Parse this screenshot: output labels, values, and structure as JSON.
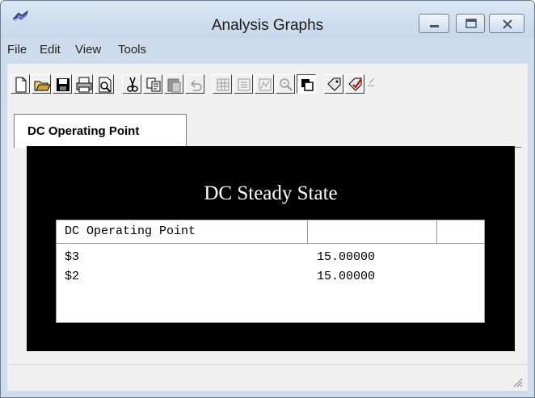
{
  "window": {
    "title": "Analysis Graphs"
  },
  "menu": {
    "items": [
      "File",
      "Edit",
      "View",
      "Tools"
    ]
  },
  "toolbar": {
    "icons": [
      "new-file-icon",
      "open-folder-icon",
      "save-icon",
      "print-icon",
      "print-preview-icon",
      "cut-icon",
      "copy-icon",
      "paste-icon",
      "undo-icon",
      "grid-icon",
      "list-icon",
      "chart-view-icon",
      "zoom-out-icon",
      "overlay-icon",
      "tag-icon",
      "edit-icon",
      "more-icon"
    ]
  },
  "tabs": [
    {
      "label": "DC Operating Point",
      "active": true
    }
  ],
  "graph": {
    "title": "DC Steady State",
    "table": {
      "header": [
        "DC Operating Point",
        "",
        ""
      ],
      "rows": [
        {
          "name": "$3",
          "value": "15.00000"
        },
        {
          "name": "$2",
          "value": "15.00000"
        }
      ]
    }
  },
  "colors": {
    "panel_bg": "#000000",
    "marker": "#e00000",
    "window_frame": "#cfdceb"
  }
}
